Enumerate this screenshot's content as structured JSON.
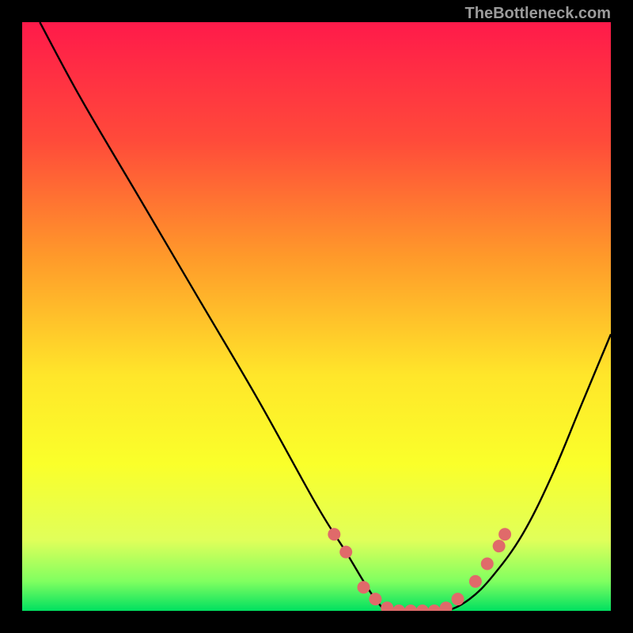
{
  "watermark": "TheBottleneck.com",
  "chart_data": {
    "type": "line",
    "title": "",
    "xlabel": "",
    "ylabel": "",
    "xlim": [
      0,
      100
    ],
    "ylim": [
      0,
      100
    ],
    "gradient_stops": [
      {
        "offset": 0,
        "color": "#ff1a4a"
      },
      {
        "offset": 20,
        "color": "#ff4a3a"
      },
      {
        "offset": 40,
        "color": "#ff9a2a"
      },
      {
        "offset": 60,
        "color": "#ffe62a"
      },
      {
        "offset": 75,
        "color": "#faff2a"
      },
      {
        "offset": 88,
        "color": "#e0ff5a"
      },
      {
        "offset": 95,
        "color": "#80ff60"
      },
      {
        "offset": 100,
        "color": "#00e060"
      }
    ],
    "series": [
      {
        "name": "bottleneck-curve",
        "x": [
          3,
          10,
          20,
          30,
          40,
          50,
          55,
          58,
          60,
          62,
          65,
          68,
          72,
          76,
          80,
          85,
          90,
          95,
          100
        ],
        "y": [
          100,
          87,
          70,
          53,
          36,
          18,
          10,
          5,
          2,
          0,
          0,
          0,
          0,
          2,
          6,
          13,
          23,
          35,
          47
        ]
      }
    ],
    "markers": {
      "name": "highlight-points",
      "color": "#e06a6a",
      "radius": 8,
      "points": [
        {
          "x": 53,
          "y": 13
        },
        {
          "x": 55,
          "y": 10
        },
        {
          "x": 58,
          "y": 4
        },
        {
          "x": 60,
          "y": 2
        },
        {
          "x": 62,
          "y": 0.5
        },
        {
          "x": 64,
          "y": 0
        },
        {
          "x": 66,
          "y": 0
        },
        {
          "x": 68,
          "y": 0
        },
        {
          "x": 70,
          "y": 0
        },
        {
          "x": 72,
          "y": 0.5
        },
        {
          "x": 74,
          "y": 2
        },
        {
          "x": 77,
          "y": 5
        },
        {
          "x": 79,
          "y": 8
        },
        {
          "x": 81,
          "y": 11
        },
        {
          "x": 82,
          "y": 13
        }
      ]
    }
  }
}
